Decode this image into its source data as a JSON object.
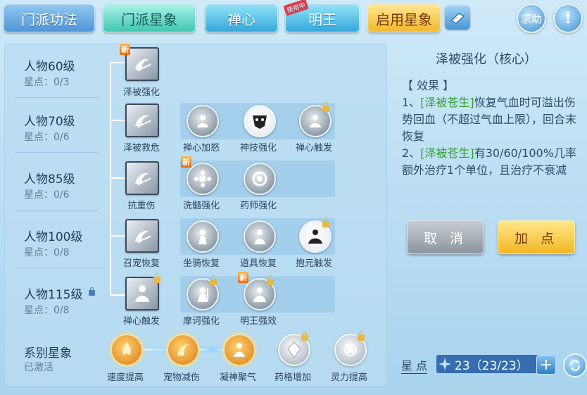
{
  "tabs": [
    {
      "label": "门派功法"
    },
    {
      "label": "门派星象"
    },
    {
      "label": "禅心"
    },
    {
      "label": "明王",
      "badge": "使用中"
    },
    {
      "label": "启用星象"
    }
  ],
  "help_label": "求助",
  "info_label": "!",
  "rows": [
    {
      "level": "人物60级",
      "points": "星点：0/3"
    },
    {
      "level": "人物70级",
      "points": "星点：0/6"
    },
    {
      "level": "人物85级",
      "points": "星点：0/6"
    },
    {
      "level": "人物100级",
      "points": "星点：0/8"
    },
    {
      "level": "人物115级",
      "points": "星点：0/8"
    }
  ],
  "skills": {
    "r1": [
      "泽被强化"
    ],
    "r2": [
      "泽被救危",
      "禅心加怒",
      "神技强化",
      "禅心触发"
    ],
    "r3": [
      "抗重伤",
      "洗髓强化",
      "药师强化"
    ],
    "r4": [
      "召宠恢复",
      "坐骑恢复",
      "道具恢复",
      "抱元触发"
    ],
    "r5": [
      "禅心触发",
      "摩诃强化",
      "明王强效"
    ]
  },
  "new_tag": "新",
  "series": {
    "title": "系别星象",
    "status": "已激活",
    "items": [
      "速度提高",
      "宠物减伤",
      "凝神聚气",
      "药格增加",
      "灵力提高"
    ]
  },
  "detail": {
    "title": "泽被强化（核心）",
    "effect_header": "【 效果 】",
    "line1_prefix": "1、",
    "line1_green": "[泽被苍生]",
    "line1_rest": "恢复气血时可溢出伤势回血（不超过气血上限），回合末恢复",
    "line2_prefix": "2、",
    "line2_green": "[泽被苍生]",
    "line2_rest": "有30/60/100%几率额外治疗1个单位，且治疗不衰减"
  },
  "buttons": {
    "cancel": "取 消",
    "add": "加 点"
  },
  "starpoints": {
    "label": "星 点",
    "value": "23（23/23）"
  }
}
